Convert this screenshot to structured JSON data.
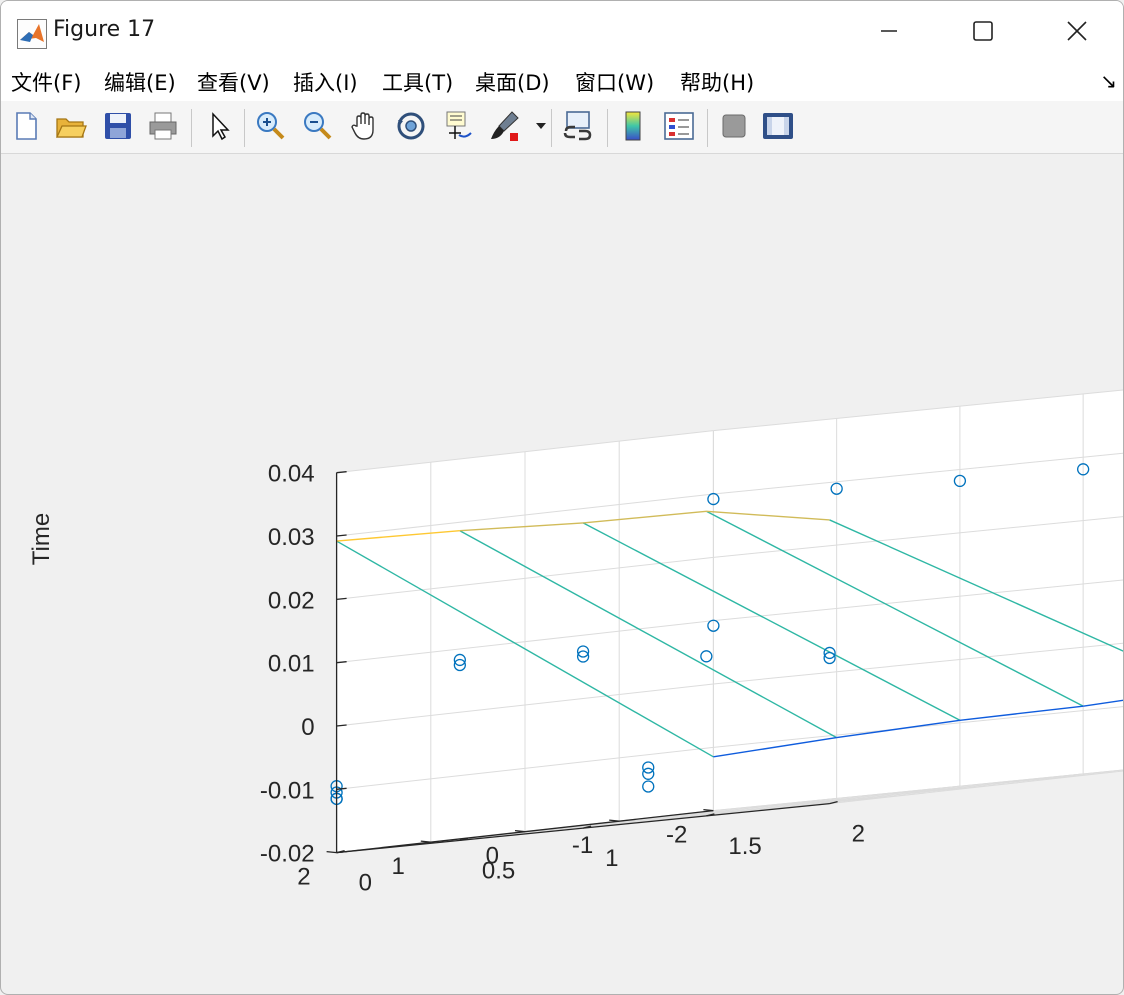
{
  "window": {
    "title": "Figure 17",
    "menu": [
      "文件(F)",
      "编辑(E)",
      "查看(V)",
      "插入(I)",
      "工具(T)",
      "桌面(D)",
      "窗口(W)",
      "帮助(H)"
    ],
    "menu_overflow_icon": "dock-arrow-icon"
  },
  "toolbar": {
    "buttons": [
      "new-figure-icon",
      "open-file-icon",
      "save-icon",
      "print-icon",
      "edit-plot-arrow-icon",
      "zoom-in-icon",
      "zoom-out-icon",
      "pan-hand-icon",
      "rotate-3d-icon",
      "data-cursor-icon",
      "brush-icon",
      "link-plot-icon",
      "colorbar-icon",
      "legend-icon",
      "hide-plot-tools-icon",
      "show-plot-tools-icon"
    ]
  },
  "chart_data": {
    "type": "mesh3d",
    "zlabel": "Time",
    "xlim": [
      0,
      2
    ],
    "ylim": [
      -2,
      2
    ],
    "zlim": [
      -0.02,
      0.04
    ],
    "x_ticks": [
      "0",
      "0.5",
      "1",
      "1.5",
      "2"
    ],
    "y_ticks": [
      "-2",
      "-1",
      "0",
      "1",
      "2"
    ],
    "z_ticks": [
      "-0.02",
      "-0.01",
      "0",
      "0.01",
      "0.02",
      "0.03",
      "0.04"
    ],
    "grid": true,
    "colormap": "parula",
    "surface": {
      "x": [
        0,
        0.5,
        1,
        1.5,
        2
      ],
      "y": [
        -2,
        2
      ],
      "z": [
        [
          -0.0115,
          0.0292
        ],
        [
          -0.0104,
          0.0289
        ],
        [
          -0.0096,
          0.0282
        ],
        [
          -0.0093,
          0.0281
        ],
        [
          -0.0084,
          0.0248
        ]
      ]
    },
    "markers": [
      {
        "x": 0,
        "y": 2,
        "z": -0.0095
      },
      {
        "x": 0,
        "y": 2,
        "z": -0.0105
      },
      {
        "x": 0,
        "y": 2,
        "z": -0.0115
      },
      {
        "x": 0.5,
        "y": 2,
        "z": 0.0085
      },
      {
        "x": 0.5,
        "y": 2,
        "z": 0.0077
      },
      {
        "x": 1,
        "y": 2,
        "z": 0.0079
      },
      {
        "x": 1,
        "y": 2,
        "z": 0.0071
      },
      {
        "x": 1.5,
        "y": 2,
        "z": 0.0052
      },
      {
        "x": 2,
        "y": 2,
        "z": 0.0038
      },
      {
        "x": 2,
        "y": 2,
        "z": 0.003
      },
      {
        "x": 0,
        "y": -2,
        "z": 0.0092
      },
      {
        "x": 0,
        "y": 2,
        "z": -0.0115
      },
      {
        "x": 0.5,
        "y": 0,
        "z": -0.0118
      },
      {
        "x": 0.5,
        "y": 0,
        "z": -0.0128
      },
      {
        "x": 0.5,
        "y": 0,
        "z": -0.0148
      },
      {
        "x": 0,
        "y": -2,
        "z": 0.0292
      },
      {
        "x": 0.5,
        "y": -2,
        "z": 0.0289
      },
      {
        "x": 1,
        "y": -2,
        "z": 0.0282
      },
      {
        "x": 1.5,
        "y": -2,
        "z": 0.0281
      },
      {
        "x": 2,
        "y": -2,
        "z": 0.0248
      }
    ]
  }
}
